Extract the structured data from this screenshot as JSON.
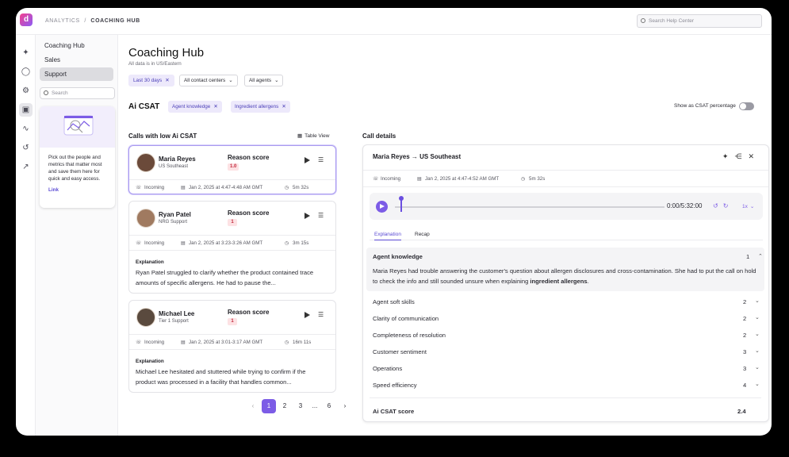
{
  "app": {
    "logo": "d"
  },
  "breadcrumb": {
    "root": "ANALYTICS",
    "sep": "/",
    "current": "COACHING HUB"
  },
  "help_search": {
    "placeholder": "Search Help Center"
  },
  "rail_icons": [
    "sparkle-icon",
    "user-icon",
    "settings-icon",
    "coaching-icon",
    "pulse-icon",
    "history-icon",
    "trend-icon"
  ],
  "subnav": {
    "items": [
      {
        "label": "Coaching Hub"
      },
      {
        "label": "Sales"
      },
      {
        "label": "Support"
      }
    ],
    "search_placeholder": "Search",
    "promo": {
      "text": "Pick out the people and metrics that matter most and save them here for quick and easy access.",
      "link": "Link"
    }
  },
  "header": {
    "title": "Coaching Hub",
    "timezone": "All data is in US/Eastern",
    "filters": {
      "date": "Last 30 days",
      "centers": "All contact centers",
      "agents": "All agents"
    }
  },
  "csat": {
    "title": "Ai CSAT",
    "chips": [
      "Agent knowledge",
      "Ingredient allergens"
    ],
    "toggle_label": "Show as CSAT percentage"
  },
  "calls": {
    "title": "Calls with low Ai CSAT",
    "table_view": "Table View",
    "reason_label": "Reason score",
    "explanation_label": "Explanation",
    "items": [
      {
        "name": "Maria Reyes",
        "team": "US Southeast",
        "score": "1.0",
        "direction": "Incoming",
        "datetime": "Jan 2, 2025 at 4:47-4:48 AM GMT",
        "duration": "5m 32s"
      },
      {
        "name": "Ryan Patel",
        "team": "NRG Support",
        "score": "1",
        "direction": "Incoming",
        "datetime": "Jan 2, 2025 at 3:23-3:26 AM GMT",
        "duration": "3m 15s",
        "explanation": "Ryan Patel struggled to clarify whether the product contained trace amounts of specific allergens. He had to pause the..."
      },
      {
        "name": "Michael Lee",
        "team": "Tier 1 Support",
        "score": "1",
        "direction": "Incoming",
        "datetime": "Jan 2, 2025 at 3:01-3:17 AM GMT",
        "duration": "16m 11s",
        "explanation": "Michael Lee hesitated and stuttered while trying to confirm if the product was processed in a facility that handles common..."
      }
    ]
  },
  "pagination": {
    "prev": "‹",
    "pages": [
      "1",
      "2",
      "3",
      "...",
      "6"
    ],
    "next": "›",
    "current": "1"
  },
  "details": {
    "title": "Call details",
    "header": "Maria Reyes → US Southeast",
    "direction": "Incoming",
    "datetime": "Jan 2, 2025 at 4:47-4:52 AM GMT",
    "duration": "5m 32s",
    "player": {
      "time": "0:00/5:32:00",
      "speed": "1x",
      "progress": 0.02
    },
    "tabs": [
      "Explanation",
      "Recap"
    ],
    "criteria": [
      {
        "name": "Agent knowledge",
        "value": "1",
        "text_before": "Maria Reyes had trouble answering the customer's question about allergen disclosures and cross-contamination. She had to put the call on hold to check the info and still sounded unsure when explaining ",
        "text_bold": "ingredient allergens",
        "text_after": "."
      },
      {
        "name": "Agent soft skills",
        "value": "2"
      },
      {
        "name": "Clarity of communication",
        "value": "2"
      },
      {
        "name": "Completeness of resolution",
        "value": "2"
      },
      {
        "name": "Customer sentiment",
        "value": "3"
      },
      {
        "name": "Operations",
        "value": "3"
      },
      {
        "name": "Speed efficiency",
        "value": "4"
      }
    ],
    "score_label": "Ai CSAT score",
    "score_value": "2.4"
  }
}
